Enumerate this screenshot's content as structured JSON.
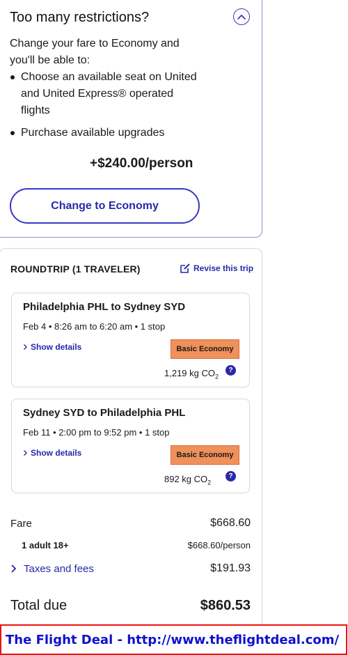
{
  "upsell": {
    "title": "Too many restrictions?",
    "intro": "Change your fare to Economy and you'll be able to:",
    "bullets": [
      "Choose an available seat on United and United Express® operated flights",
      "Purchase available upgrades"
    ],
    "upcharge": "+$240.00/person",
    "change_button": "Change to Economy",
    "collapse_icon": "chevron-up-icon"
  },
  "summary": {
    "trip_label": "ROUNDTRIP (1 TRAVELER)",
    "revise_label": "Revise this trip",
    "flights": [
      {
        "route": "Philadelphia PHL to Sydney SYD",
        "times": "Feb 4 • 8:26 am to 6:20 am • 1 stop",
        "details_label": "Show details",
        "fare_class": "Basic Economy",
        "co2_value": "1,219 kg CO",
        "co2_sub": "2",
        "help": "?"
      },
      {
        "route": "Sydney SYD to Philadelphia PHL",
        "times": "Feb 11 • 2:00 pm to 9:52 pm • 1 stop",
        "details_label": "Show details",
        "fare_class": "Basic Economy",
        "co2_value": "892 kg CO",
        "co2_sub": "2",
        "help": "?"
      }
    ],
    "fare_label": "Fare",
    "fare_amount": "$668.60",
    "adult_label": "1 adult 18+",
    "adult_amount": "$668.60/person",
    "taxes_label": "Taxes and fees",
    "taxes_amount": "$191.93",
    "total_label": "Total due",
    "total_amount": "$860.53"
  },
  "watermark": "The Flight Deal - http://www.theflightdeal.com/",
  "colors": {
    "accent": "#2a27a8",
    "badge": "#f0905a",
    "watermark_border": "#ee1111",
    "watermark_text": "#1010d0"
  }
}
